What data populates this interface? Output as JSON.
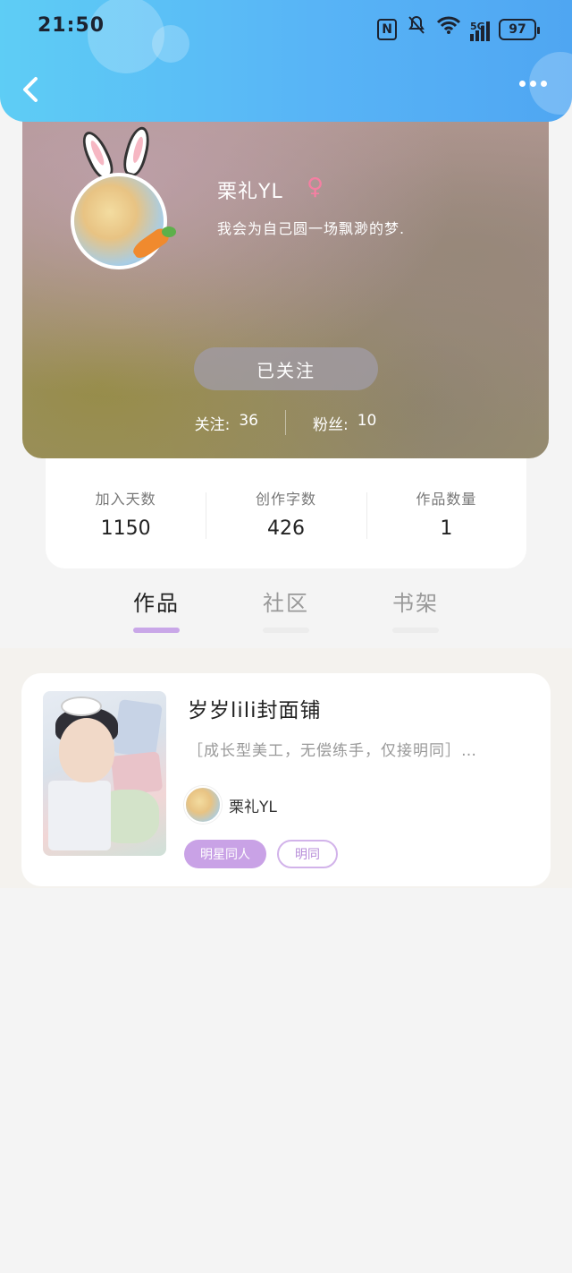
{
  "status_bar": {
    "time": "21:50",
    "nfc": "N",
    "network": "5G",
    "battery": "97"
  },
  "nav": {
    "back_icon": "chevron-left-icon",
    "more_icon": "more-dots-icon"
  },
  "profile": {
    "username": "栗礼YL",
    "gender_icon": "♀",
    "bio": "我会为自己圆一场飘渺的梦.",
    "follow_button": "已关注",
    "following_label": "关注:",
    "following_count": "36",
    "followers_label": "粉丝:",
    "followers_count": "10"
  },
  "counts": [
    {
      "label": "加入天数",
      "value": "1150"
    },
    {
      "label": "创作字数",
      "value": "426"
    },
    {
      "label": "作品数量",
      "value": "1"
    }
  ],
  "tabs": [
    {
      "label": "作品",
      "active": true
    },
    {
      "label": "社区",
      "active": false
    },
    {
      "label": "书架",
      "active": false
    }
  ],
  "works": [
    {
      "title": "岁岁lili封面铺",
      "description": "［成长型美工，无偿练手，仅接明同］…",
      "author": "栗礼YL",
      "tags": [
        "明星同人",
        "明同"
      ]
    }
  ],
  "colors": {
    "header_start": "#5ecdf5",
    "header_end": "#4fa6f2",
    "accent_purple": "#c9a2e6",
    "female_pink": "#f57fa2"
  }
}
